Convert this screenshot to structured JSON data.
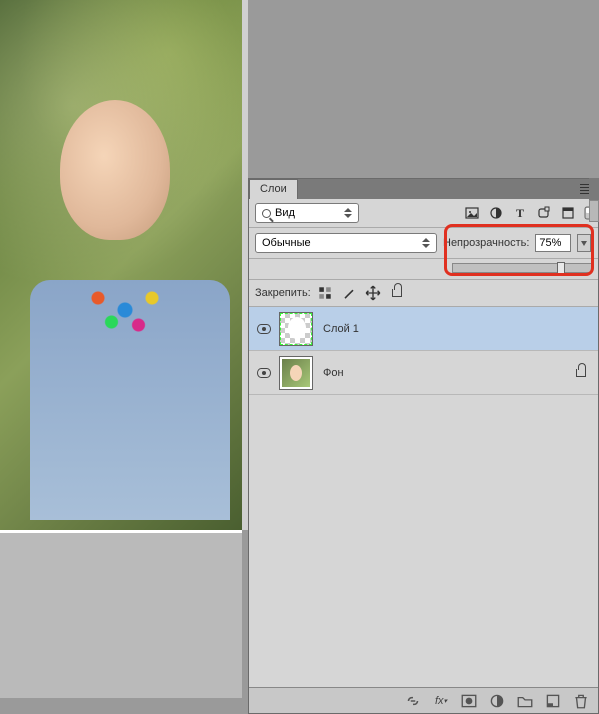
{
  "panel": {
    "tab_label": "Слои",
    "filter_kind": "Вид",
    "blend_mode": "Обычные",
    "opacity_label": "Непрозрачность:",
    "opacity_value": "75%",
    "opacity_percent": 75,
    "lock_label": "Закрепить:"
  },
  "filter_icons": [
    "image-filter-icon",
    "adjustment-filter-icon",
    "type-filter-icon",
    "shape-filter-icon",
    "smart-filter-icon"
  ],
  "lock_icons": [
    "lock-pixels-icon",
    "lock-brush-icon",
    "lock-position-icon",
    "lock-all-icon"
  ],
  "layers": [
    {
      "name": "Слой 1",
      "visible": true,
      "selected": true,
      "locked": false,
      "thumb": "transparent-cutout"
    },
    {
      "name": "Фон",
      "visible": true,
      "selected": false,
      "locked": true,
      "thumb": "photo"
    }
  ],
  "footer_icons": [
    "link-icon",
    "fx-icon",
    "mask-icon",
    "adjustment-icon",
    "group-icon",
    "new-layer-icon",
    "trash-icon"
  ]
}
